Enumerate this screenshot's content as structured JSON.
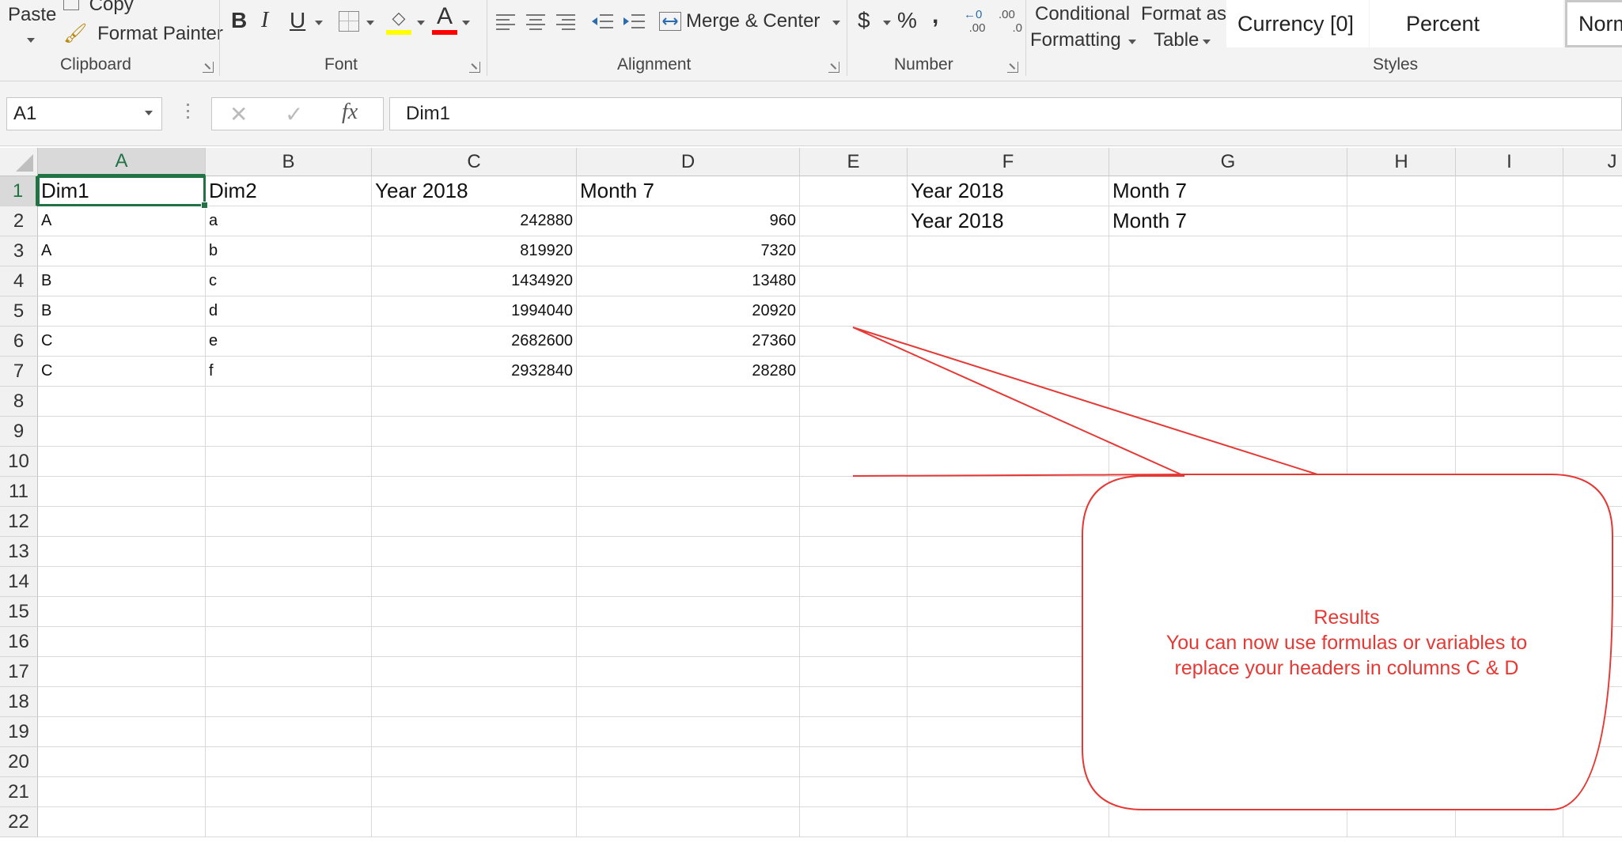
{
  "ribbon": {
    "clipboard": {
      "paste_label": "Paste",
      "copy_label": "Copy",
      "format_painter_label": "Format Painter",
      "group_label": "Clipboard"
    },
    "font": {
      "bold": "B",
      "italic": "I",
      "underline": "U",
      "font_color_glyph": "A",
      "highlight_color": "#ffff00",
      "font_color": "#ff0000",
      "group_label": "Font"
    },
    "alignment": {
      "merge_label": "Merge & Center",
      "group_label": "Alignment"
    },
    "number": {
      "currency_symbol": "$",
      "percent_symbol": "%",
      "comma_symbol": ",",
      "inc_decimal": ".00",
      "dec_decimal": ".0",
      "group_label": "Number"
    },
    "styles": {
      "conditional_line1": "Conditional",
      "conditional_line2": "Formatting",
      "format_table_line1": "Format as",
      "format_table_line2": "Table",
      "style_currency": "Currency [0]",
      "style_percent": "Percent",
      "style_normal": "Norm",
      "group_label": "Styles"
    }
  },
  "formula_bar": {
    "name_box": "A1",
    "cancel_glyph": "✕",
    "enter_glyph": "✓",
    "fx_label": "fx",
    "formula_value": "Dim1"
  },
  "sheet": {
    "columns": [
      "A",
      "B",
      "C",
      "D",
      "E",
      "F",
      "G",
      "H",
      "I",
      "J"
    ],
    "selected_column": "A",
    "selected_row": "1",
    "rows": [
      "1",
      "2",
      "3",
      "4",
      "5",
      "6",
      "7",
      "8",
      "9",
      "10",
      "11",
      "12",
      "13",
      "14",
      "15",
      "16",
      "17",
      "18",
      "19",
      "20",
      "21",
      "22"
    ],
    "cells": {
      "A1": "Dim1",
      "B1": "Dim2",
      "C1": "Year 2018",
      "D1": "Month 7",
      "F1": "Year 2018",
      "G1": "Month 7",
      "A2": "A",
      "B2": "a",
      "C2": "242880",
      "D2": "960",
      "F2": "Year 2018",
      "G2": "Month 7",
      "A3": "A",
      "B3": "b",
      "C3": "819920",
      "D3": "7320",
      "A4": "B",
      "B4": "c",
      "C4": "1434920",
      "D4": "13480",
      "A5": "B",
      "B5": "d",
      "C5": "1994040",
      "D5": "20920",
      "A6": "C",
      "B6": "e",
      "C6": "2682600",
      "D6": "27360",
      "A7": "C",
      "B7": "f",
      "C7": "2932840",
      "D7": "28280"
    }
  },
  "callout": {
    "line1": "Results",
    "line2": "You can now use formulas or variables to",
    "line3": "replace your headers in columns C & D",
    "color": "#e53935"
  },
  "accent_color": "#217346"
}
